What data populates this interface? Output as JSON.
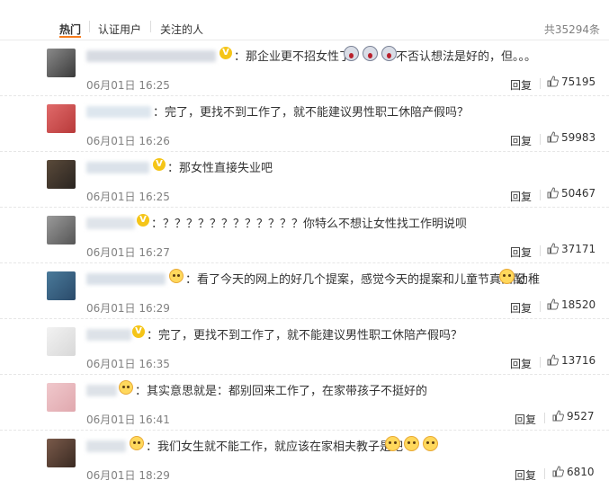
{
  "tabs": {
    "items": [
      {
        "label": "热门"
      },
      {
        "label": "认证用户"
      },
      {
        "label": "关注的人"
      }
    ],
    "total": "共35294条"
  },
  "comments": [
    {
      "text": "：那企业更不招女性了",
      "text_after_emoji": " 不否认想法是好的，但。。。",
      "time": "06月01日 16:25",
      "reply": "回复",
      "likes": "75195"
    },
    {
      "text": "：完了，更找不到工作了，就不能建议男性职工休陪产假吗？",
      "time": "06月01日 16:26",
      "reply": "回复",
      "likes": "59983"
    },
    {
      "text": "：那女性直接失业吧",
      "time": "06月01日 16:25",
      "reply": "回复",
      "likes": "50467"
    },
    {
      "text": "：？？？？？？？？？？？？你特么不想让女性找工作明说呗",
      "time": "06月01日 16:27",
      "reply": "回复",
      "likes": "37171"
    },
    {
      "text": "：看了今天的网上的好几个提案，感觉今天的提案和儿童节真匹配",
      "text_after_emoji": "幼稚",
      "time": "06月01日 16:29",
      "reply": "回复",
      "likes": "18520"
    },
    {
      "text": "：完了，更找不到工作了，就不能建议男性职工休陪产假吗？",
      "time": "06月01日 16:35",
      "reply": "回复",
      "likes": "13716"
    },
    {
      "text": "：其实意思就是：都别回来工作了，在家带孩子不挺好的",
      "time": "06月01日 16:41",
      "reply": "回复",
      "likes": "9527"
    },
    {
      "text": "：我们女生就不能工作，就应该在家相夫教子是吧",
      "time": "06月01日 18:29",
      "reply": "回复",
      "likes": "6810"
    }
  ],
  "colors": {
    "accent": "#f77c1d",
    "muted": "#808080",
    "badge": "#f5c518"
  }
}
